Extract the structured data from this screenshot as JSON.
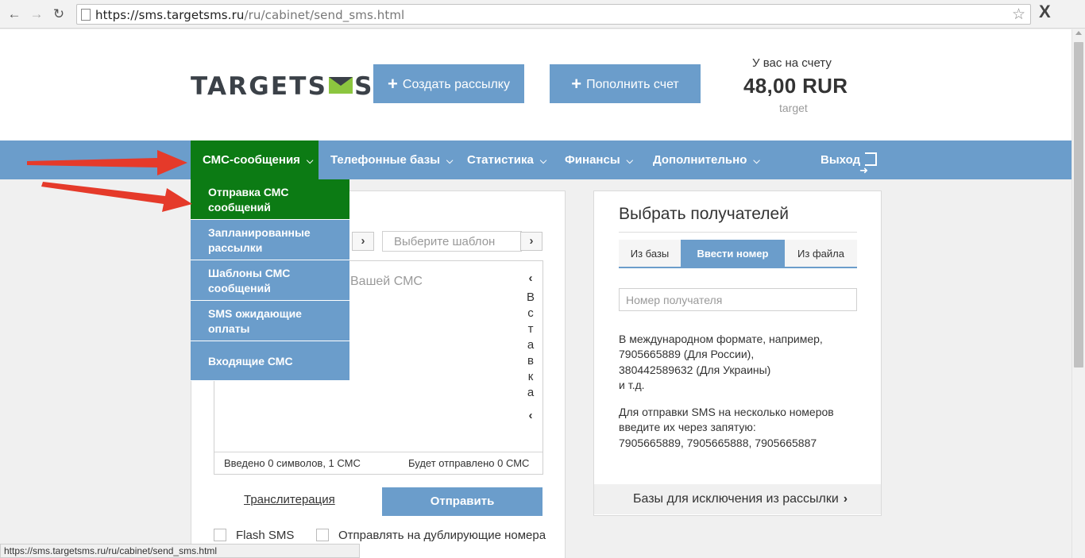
{
  "browser": {
    "url_host": "https://sms.targetsms.ru",
    "url_path": "/ru/cabinet/send_sms.html",
    "ext_label": "X",
    "status_url": "https://sms.targetsms.ru/ru/cabinet/send_sms.html"
  },
  "header": {
    "logo_left": "TARGETS",
    "logo_right": "S",
    "create_button": "Создать рассылку",
    "topup_button": "Пополнить счет",
    "balance_label": "У вас на счету",
    "balance_value": "48,00 RUR",
    "balance_login": "target"
  },
  "nav": {
    "items": [
      {
        "label": "СМС-сообщения"
      },
      {
        "label": "Телефонные базы"
      },
      {
        "label": "Статистика"
      },
      {
        "label": "Финансы"
      },
      {
        "label": "Дополнительно"
      }
    ],
    "logout": "Выход"
  },
  "dropdown": {
    "items": [
      {
        "label": "Отправка СМС сообщений"
      },
      {
        "label": "Запланированные рассылки"
      },
      {
        "label": "Шаблоны СМС сообщений"
      },
      {
        "label": "SMS ожидающие оплаты"
      },
      {
        "label": "Входящие СМС"
      }
    ]
  },
  "compose": {
    "template_placeholder": "Выберите шаблон",
    "text_placeholder": "Вашей СМС",
    "insert_label": "Вставка",
    "insert_letters": [
      "В",
      "с",
      "т",
      "а",
      "в",
      "к",
      "а"
    ],
    "counter_entered": "Введено 0 символов, 1 СМС",
    "counter_sent": "Будет отправлено 0 СМС",
    "translit": "Транслитерация",
    "send_button": "Отправить",
    "flash_sms": "Flash SMS",
    "duplicate": "Отправлять на дублирующие номера"
  },
  "recipients": {
    "title": "Выбрать получателей",
    "tabs": [
      {
        "label": "Из базы"
      },
      {
        "label": "Ввести номер"
      },
      {
        "label": "Из файла"
      }
    ],
    "input_placeholder": "Номер получателя",
    "hint1_lines": [
      "В международном формате, например,",
      "7905665889 (Для России),",
      "380442589632 (Для Украины)",
      "и т.д."
    ],
    "hint2_lines": [
      "Для отправки SMS на несколько номеров",
      "введите их через запятую:",
      "7905665889, 7905665888, 7905665887"
    ],
    "exclusion_link": "Базы для исключения из рассылки"
  },
  "colors": {
    "accent_blue": "#6b9dcb",
    "active_green": "#0c7b14",
    "annotation_red": "#e53a2a"
  }
}
